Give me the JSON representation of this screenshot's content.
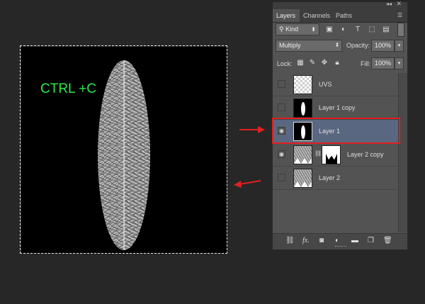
{
  "canvas": {
    "overlay_text": "CTRL +C"
  },
  "panel": {
    "tabs": [
      "Layers",
      "Channels",
      "Paths"
    ],
    "filter": {
      "kind_label": "Kind"
    },
    "blend_mode": "Multiply",
    "opacity": {
      "label": "Opacity:",
      "value": "100%"
    },
    "lock_label": "Lock:",
    "fill": {
      "label": "Fill:",
      "value": "100%"
    },
    "layers": [
      {
        "name": "UVS",
        "visible": false,
        "selected": false,
        "thumb": "checker"
      },
      {
        "name": "Layer 1 copy",
        "visible": false,
        "selected": false,
        "thumb": "black-oval"
      },
      {
        "name": "Layer 1",
        "visible": true,
        "selected": true,
        "thumb": "black-oval"
      },
      {
        "name": "Layer 2 copy",
        "visible": true,
        "selected": false,
        "thumb": "noise",
        "has_mask": true
      },
      {
        "name": "Layer 2",
        "visible": false,
        "selected": false,
        "thumb": "noise"
      }
    ]
  },
  "colors": {
    "annotation": "#e02020",
    "overlay_text": "#2ee84a",
    "selected_row": "#5a6780"
  }
}
